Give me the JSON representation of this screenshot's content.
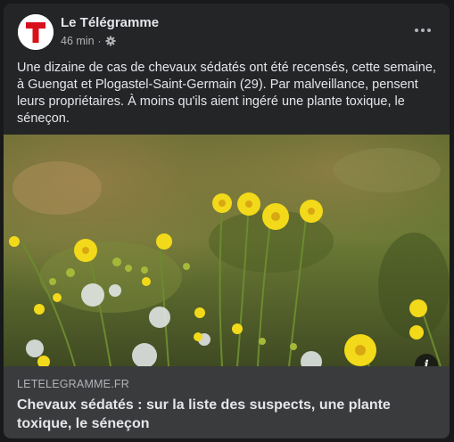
{
  "post": {
    "page_name": "Le Télégramme",
    "time": "46 min",
    "separator": "·",
    "privacy_icon": "gear-icon",
    "more_icon": "more-options-icon",
    "text": "Une dizaine de cas de chevaux sédatés ont été recensés, cette semaine, à Guengat et Plogastel-Saint-Germain (29). Par malveillance, pensent leurs propriétaires. À moins qu'ils aient ingéré une plante toxique, le séneçon.",
    "avatar_letter": "T"
  },
  "image": {
    "info_label": "i"
  },
  "link": {
    "domain": "LETELEGRAMME.FR",
    "title": "Chevaux sédatés : sur la liste des suspects, une plante toxique, le séneçon"
  },
  "colors": {
    "background": "#18191a",
    "card": "#242526",
    "link_box": "#3a3b3c",
    "brand_red": "#d8101b"
  }
}
